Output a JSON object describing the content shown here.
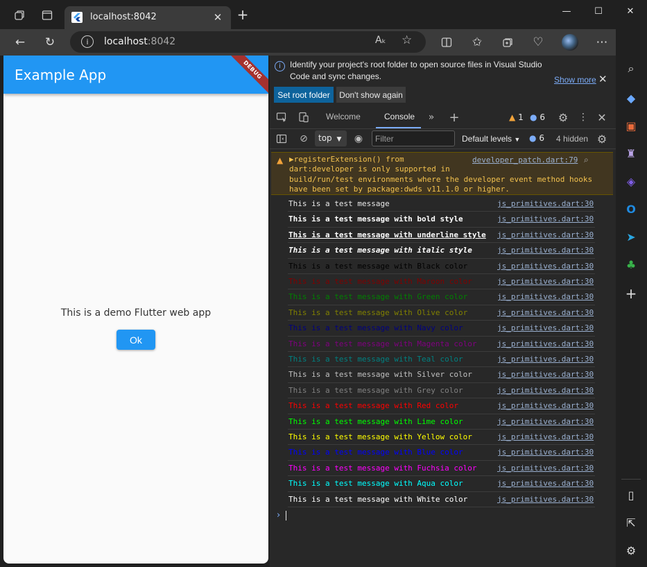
{
  "browser": {
    "tab_title": "localhost:8042",
    "new_tab": "+",
    "url_host": "localhost",
    "url_port": ":8042",
    "read_aloud": "Aₖ",
    "icons": [
      "tab-actions-icon",
      "vertical-tabs-icon",
      "close-icon",
      "new-tab-icon",
      "minimize-icon",
      "maximize-icon",
      "close-window-icon",
      "back-icon",
      "refresh-icon",
      "info-icon",
      "read-aloud-icon",
      "favorite-icon",
      "split-screen-icon",
      "favorites-icon",
      "collections-icon",
      "performance-icon",
      "profile-icon",
      "more-icon",
      "copilot-icon"
    ]
  },
  "app": {
    "title": "Example App",
    "debug_banner": "DEBUG",
    "body_text": "This is a demo Flutter web app",
    "ok_label": "Ok",
    "appbar_color": "#2196f3"
  },
  "devtools": {
    "info_message": "Identify your project's root folder to open source files in Visual Studio Code and sync changes.",
    "show_more": "Show more",
    "set_root_folder": "Set root folder",
    "dont_show_again": "Don't show again",
    "tabs": [
      "Welcome",
      "Console"
    ],
    "warning_count": "1",
    "info_count": "6",
    "context": "top",
    "filter_placeholder": "Filter",
    "levels": "Default levels",
    "levels_info_count": "6",
    "hidden": "4 hidden",
    "warning": {
      "text": "▶registerExtension() from\ndart:developer is only supported in\nbuild/run/test environments where the developer event method hooks\nhave been set by package:dwds v11.1.0 or higher.",
      "link": "developer_patch.dart:79"
    },
    "messages": [
      {
        "text": "This is a test message",
        "color": "#e8e8e8",
        "style": "normal",
        "link": "js_primitives.dart:30"
      },
      {
        "text": "This is a test message with bold style",
        "color": "#ffffff",
        "style": "bold",
        "link": "js_primitives.dart:30"
      },
      {
        "text": "This is a test message with underline style",
        "color": "#ffffff",
        "style": "underline",
        "link": "js_primitives.dart:30"
      },
      {
        "text": "This is a test message with italic style",
        "color": "#ffffff",
        "style": "italic",
        "link": "js_primitives.dart:30"
      },
      {
        "text": "This is a test message with Black color",
        "color": "#000000",
        "style": "normal",
        "link": "js_primitives.dart:30"
      },
      {
        "text": "This is a test message with Maroon color",
        "color": "#800000",
        "style": "normal",
        "link": "js_primitives.dart:30"
      },
      {
        "text": "This is a test message with Green color",
        "color": "#008000",
        "style": "normal",
        "link": "js_primitives.dart:30"
      },
      {
        "text": "This is a test message with Olive color",
        "color": "#808000",
        "style": "normal",
        "link": "js_primitives.dart:30"
      },
      {
        "text": "This is a test message with Navy color",
        "color": "#000080",
        "style": "normal",
        "link": "js_primitives.dart:30"
      },
      {
        "text": "This is a test message with Magenta color",
        "color": "#800080",
        "style": "normal",
        "link": "js_primitives.dart:30"
      },
      {
        "text": "This is a test message with Teal color",
        "color": "#008080",
        "style": "normal",
        "link": "js_primitives.dart:30"
      },
      {
        "text": "This is a test message with Silver color",
        "color": "#c0c0c0",
        "style": "normal",
        "link": "js_primitives.dart:30"
      },
      {
        "text": "This is a test message with Grey color",
        "color": "#808080",
        "style": "normal",
        "link": "js_primitives.dart:30"
      },
      {
        "text": "This is a test message with Red color",
        "color": "#ff0000",
        "style": "normal",
        "link": "js_primitives.dart:30"
      },
      {
        "text": "This is a test message with Lime color",
        "color": "#00ff00",
        "style": "normal",
        "link": "js_primitives.dart:30"
      },
      {
        "text": "This is a test message with Yellow color",
        "color": "#ffff00",
        "style": "normal",
        "link": "js_primitives.dart:30"
      },
      {
        "text": "This is a test message with Blue color",
        "color": "#0000ff",
        "style": "normal",
        "link": "js_primitives.dart:30"
      },
      {
        "text": "This is a test message with Fuchsia color",
        "color": "#ff00ff",
        "style": "normal",
        "link": "js_primitives.dart:30"
      },
      {
        "text": "This is a test message with Aqua color",
        "color": "#00ffff",
        "style": "normal",
        "link": "js_primitives.dart:30"
      },
      {
        "text": "This is a test message with White color",
        "color": "#ffffff",
        "style": "normal",
        "link": "js_primitives.dart:30"
      }
    ],
    "prompt": "›"
  },
  "sidebar": {
    "icons": [
      "search-icon",
      "shopping-icon",
      "tools-icon",
      "games-icon",
      "microsoft-365-icon",
      "outlook-icon",
      "telegram-icon",
      "tree-icon",
      "add-icon",
      "hide-sidebar-icon",
      "open-external-icon",
      "settings-icon"
    ]
  }
}
